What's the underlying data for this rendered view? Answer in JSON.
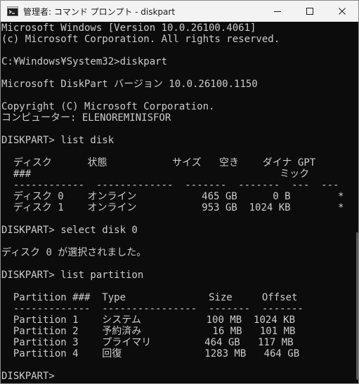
{
  "window": {
    "title": "管理者: コマンド プロンプト - diskpart",
    "icon": "cmd-icon",
    "controls": [
      "minimize-icon",
      "maximize-icon",
      "close-icon"
    ]
  },
  "console": {
    "lines": [
      "Microsoft Windows [Version 10.0.26100.4061]",
      "(c) Microsoft Corporation. All rights reserved.",
      "",
      "C:¥Windows¥System32>diskpart",
      "",
      "Microsoft DiskPart バージョン 10.0.26100.1150",
      "",
      "Copyright (C) Microsoft Corporation.",
      "コンピューター: ELENOREMINISFOR",
      "",
      "DISKPART> list disk",
      "",
      "  ディスク      状態           サイズ   空き    ダイナ GPT",
      "  ###                                          ミック",
      "  ------------  -------------  -------  -------  ---  ---",
      "  ディスク 0    オンライン           465 GB      0 B        *",
      "  ディスク 1    オンライン           953 GB  1024 KB        *",
      "",
      "DISKPART> select disk 0",
      "",
      "ディスク 0 が選択されました。",
      "",
      "DISKPART> list partition",
      "",
      "  Partition ###  Type              Size     Offset",
      "  -------------  ----------------  -------  -------",
      "  Partition 1    システム           100 MB  1024 KB",
      "  Partition 2    予約済み            16 MB   101 MB",
      "  Partition 3    プライマリ         464 GB   117 MB",
      "  Partition 4    回復              1283 MB   464 GB",
      "",
      "DISKPART>"
    ]
  },
  "colors": {
    "background": "#0c0c0c",
    "text": "#cccccc",
    "titlebar": "#f3f3f3"
  }
}
